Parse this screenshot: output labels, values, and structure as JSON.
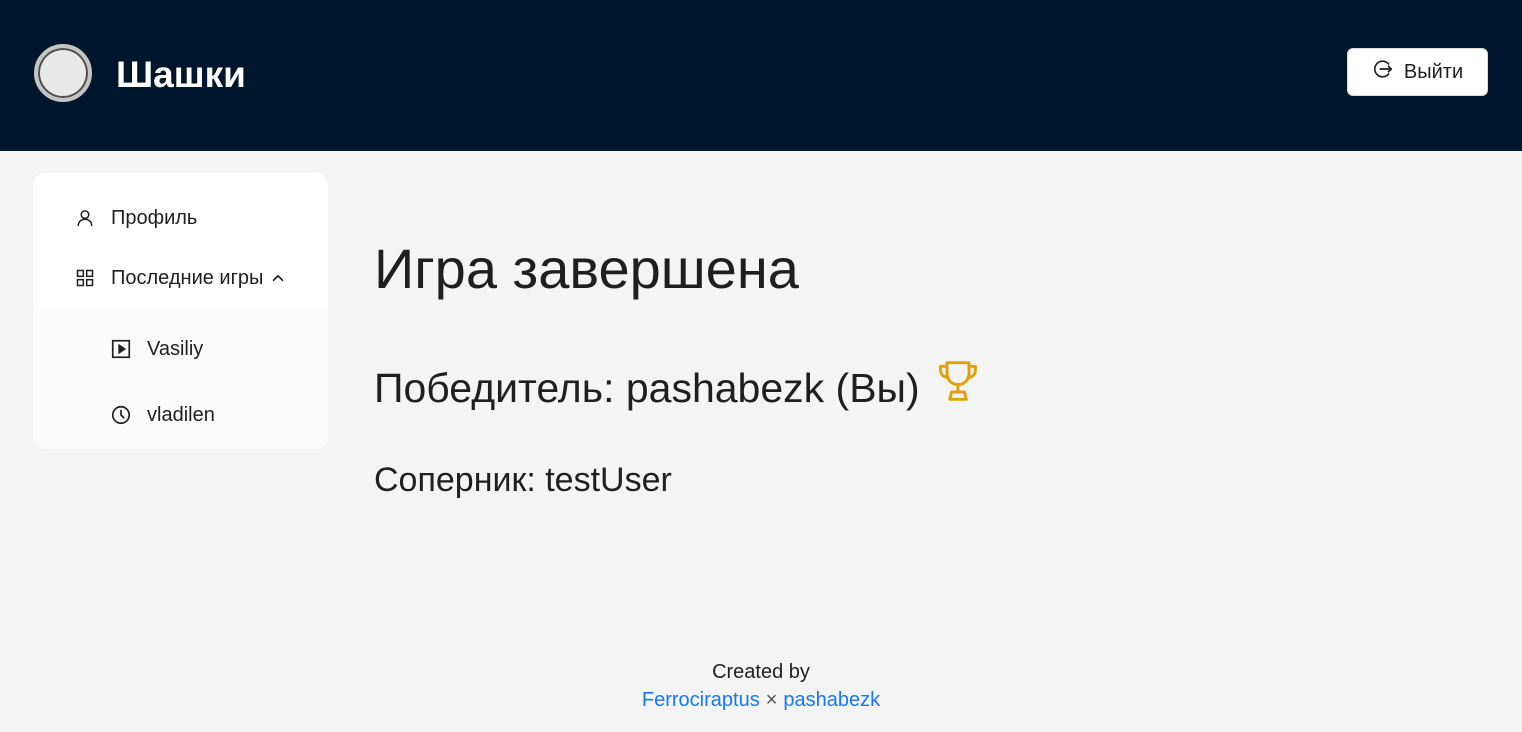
{
  "header": {
    "app_title": "Шашки",
    "logout_label": "Выйти",
    "logo_icon": "avatar-circle",
    "logout_icon": "logout-icon"
  },
  "sidebar": {
    "items": [
      {
        "label": "Профиль",
        "icon": "user-icon"
      },
      {
        "label": "Последние игры",
        "icon": "grid-icon",
        "expanded": true
      }
    ],
    "sub_items": [
      {
        "label": "Vasiliy",
        "icon": "play-square-icon"
      },
      {
        "label": "vladilen",
        "icon": "clock-icon"
      }
    ]
  },
  "main": {
    "title": "Игра завершена",
    "winner_text": "Победитель: pashabezk (Вы)",
    "opponent_text": "Соперник: testUser"
  },
  "footer": {
    "created_by": "Created by",
    "author1": "Ferrociraptus",
    "separator": "×",
    "author2": "pashabezk"
  },
  "colors": {
    "header_bg": "#00162c",
    "page_bg": "#f4f4f4",
    "link": "#1677ff",
    "trophy": "#e3a008"
  }
}
